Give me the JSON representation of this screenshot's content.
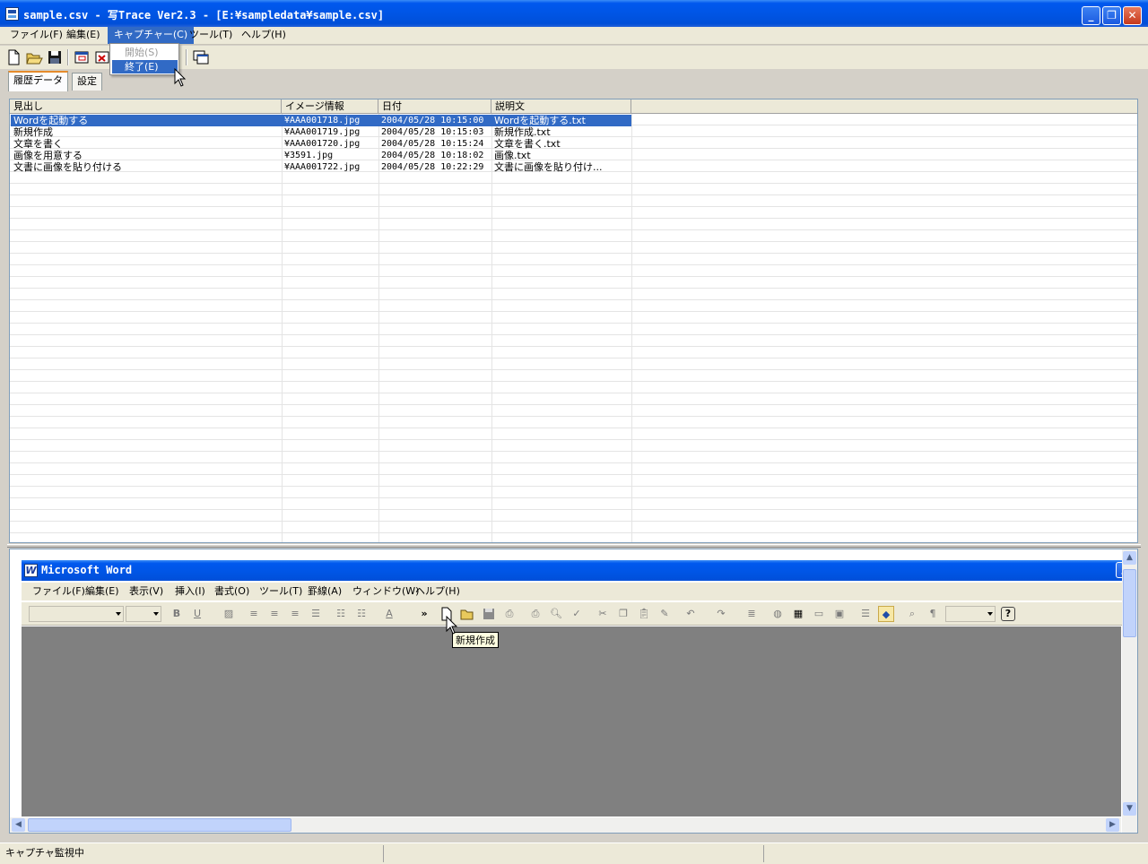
{
  "window": {
    "title": "sample.csv - 写Trace Ver2.3 - [E:¥sampledata¥sample.csv]",
    "minimize": "_",
    "restore": "❐",
    "close": "✕"
  },
  "menubar": {
    "items": [
      "ファイル(F)",
      "編集(E)",
      "キャプチャー(C)",
      "ツール(T)",
      "ヘルプ(H)"
    ],
    "active_index": 2
  },
  "toolbar": {
    "icons": [
      "new-file-icon",
      "open-folder-icon",
      "save-icon",
      "window-capture-icon",
      "window-close-icon",
      "cascade-window-icon"
    ]
  },
  "capture_menu": {
    "items": [
      {
        "label": "開始(S)",
        "state": "disabled"
      },
      {
        "label": "終了(E)",
        "state": "selected"
      }
    ]
  },
  "tabs": [
    {
      "label": "履歴データ",
      "active": true
    },
    {
      "label": "設定",
      "active": false
    }
  ],
  "history_table": {
    "columns": [
      "見出し",
      "イメージ情報",
      "日付",
      "説明文"
    ],
    "rows": [
      [
        "Wordを起動する",
        "¥AAA001718.jpg",
        "2004/05/28 10:15:00",
        "Wordを起動する.txt"
      ],
      [
        "新規作成",
        "¥AAA001719.jpg",
        "2004/05/28 10:15:03",
        "新規作成.txt"
      ],
      [
        "文章を書く",
        "¥AAA001720.jpg",
        "2004/05/28 10:15:24",
        "文章を書く.txt"
      ],
      [
        "画像を用意する",
        "¥3591.jpg",
        "2004/05/28 10:18:02",
        "画像.txt"
      ],
      [
        "文書に画像を貼り付ける",
        "¥AAA001722.jpg",
        "2004/05/28 10:22:29",
        "文書に画像を貼り付け..."
      ]
    ],
    "selected_row": 0
  },
  "word": {
    "title": "Microsoft Word",
    "logo_letter": "W",
    "menu": [
      "ファイル(F)",
      "編集(E)",
      "表示(V)",
      "挿入(I)",
      "書式(O)",
      "ツール(T)",
      "罫線(A)",
      "ウィンドウ(W)",
      "ヘルプ(H)"
    ],
    "toolbar_glyphs": {
      "bold": "B",
      "underline": "U",
      "more": "»",
      "help": "?"
    },
    "tooltip": "新規作成"
  },
  "statusbar": {
    "text": "キャプチャ監視中"
  },
  "colors": {
    "title_blue": "#0055e5",
    "selection": "#316ac5",
    "workspace_gray": "#808080"
  }
}
